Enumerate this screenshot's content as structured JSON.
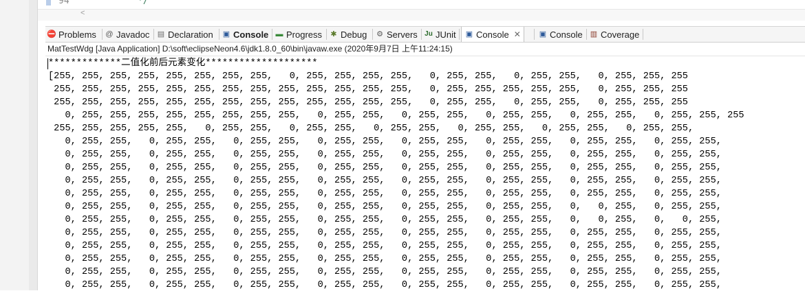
{
  "editor": {
    "line_number": "94",
    "code_text": "*/"
  },
  "tabs": [
    {
      "label": "Problems",
      "icon": "problems-icon",
      "glyph": "⛔",
      "color": "#c0392b"
    },
    {
      "label": "Javadoc",
      "icon": "javadoc-icon",
      "glyph": "@",
      "color": "#555555"
    },
    {
      "label": "Declaration",
      "icon": "declaration-icon",
      "glyph": "▤",
      "color": "#6b6b6b"
    },
    {
      "label": "Console",
      "icon": "console-icon",
      "glyph": "▣",
      "color": "#2d5a9a"
    },
    {
      "label": "Progress",
      "icon": "progress-icon",
      "glyph": "▬",
      "color": "#3a8a3a"
    },
    {
      "label": "Debug",
      "icon": "debug-icon",
      "glyph": "✱",
      "color": "#5a7a2a"
    },
    {
      "label": "Servers",
      "icon": "servers-icon",
      "glyph": "⚙",
      "color": "#5a5a5a"
    },
    {
      "label": "JUnit",
      "icon": "junit-icon",
      "glyph": "Ju",
      "color": "#2a6a2a"
    },
    {
      "label": "Console",
      "icon": "console-icon",
      "glyph": "▣",
      "color": "#2d5a9a"
    },
    {
      "label": "Console",
      "icon": "console-icon",
      "glyph": "▣",
      "color": "#2d5a9a"
    },
    {
      "label": "Coverage",
      "icon": "coverage-icon",
      "glyph": "▥",
      "color": "#8a3a2a"
    }
  ],
  "status_line": "MatTestWdg [Java Application] D:\\soft\\eclipseNeon4.6\\jdk1.8.0_60\\bin\\javaw.exe (2020年9月7日 上午11:24:15)",
  "console_lines": [
    "*************二值化前后元素变化********************",
    "[255, 255, 255, 255, 255, 255, 255, 255,   0, 255, 255, 255, 255,   0, 255, 255,   0, 255, 255,   0, 255, 255, 255",
    " 255, 255, 255, 255, 255, 255, 255, 255, 255, 255, 255, 255, 255,   0, 255, 255, 255, 255, 255,   0, 255, 255, 255",
    " 255, 255, 255, 255, 255, 255, 255, 255, 255, 255, 255, 255, 255,   0, 255, 255,   0, 255, 255,   0, 255, 255, 255",
    "   0, 255, 255, 255, 255, 255, 255, 255, 255,   0, 255, 255,   0, 255, 255,   0, 255, 255,   0, 255, 255,   0, 255, 255, 255",
    " 255, 255, 255, 255, 255,   0, 255, 255,   0, 255, 255,   0, 255, 255,   0, 255, 255,   0, 255, 255,   0, 255, 255,",
    "   0, 255, 255,   0, 255, 255,   0, 255, 255,   0, 255, 255,   0, 255, 255,   0, 255, 255,   0, 255, 255,   0, 255, 255,",
    "   0, 255, 255,   0, 255, 255,   0, 255, 255,   0, 255, 255,   0, 255, 255,   0, 255, 255,   0, 255, 255,   0, 255, 255,",
    "   0, 255, 255,   0, 255, 255,   0, 255, 255,   0, 255, 255,   0, 255, 255,   0, 255, 255,   0, 255, 255,   0, 255, 255,",
    "   0, 255, 255,   0, 255, 255,   0, 255, 255,   0, 255, 255,   0, 255, 255,   0, 255, 255,   0, 255, 255,   0, 255, 255,",
    "   0, 255, 255,   0, 255, 255,   0, 255, 255,   0, 255, 255,   0, 255, 255,   0, 255, 255,   0, 255, 255,   0, 255, 255,",
    "   0, 255, 255,   0, 255, 255,   0, 255, 255,   0, 255, 255,   0, 255, 255,   0, 255, 255,   0,   0, 255,   0, 255, 255,",
    "   0, 255, 255,   0, 255, 255,   0, 255, 255,   0, 255, 255,   0, 255, 255,   0, 255, 255,   0,   0, 255,   0,   0, 255,",
    "   0, 255, 255,   0, 255, 255,   0, 255, 255,   0, 255, 255,   0, 255, 255,   0, 255, 255,   0, 255, 255,   0, 255, 255,",
    "   0, 255, 255,   0, 255, 255,   0, 255, 255,   0, 255, 255,   0, 255, 255,   0, 255, 255,   0, 255, 255,   0, 255, 255,",
    "   0, 255, 255,   0, 255, 255,   0, 255, 255,   0, 255, 255,   0, 255, 255,   0, 255, 255,   0, 255, 255,   0, 255, 255,",
    "   0, 255, 255,   0, 255, 255,   0, 255, 255,   0, 255, 255,   0, 255, 255,   0, 255, 255,   0, 255, 255,   0, 255, 255,",
    "   0, 255, 255,   0, 255, 255,   0, 255, 255,   0, 255, 255,   0, 255, 255,   0, 255, 255,   0, 255, 255,   0, 255, 255,"
  ]
}
